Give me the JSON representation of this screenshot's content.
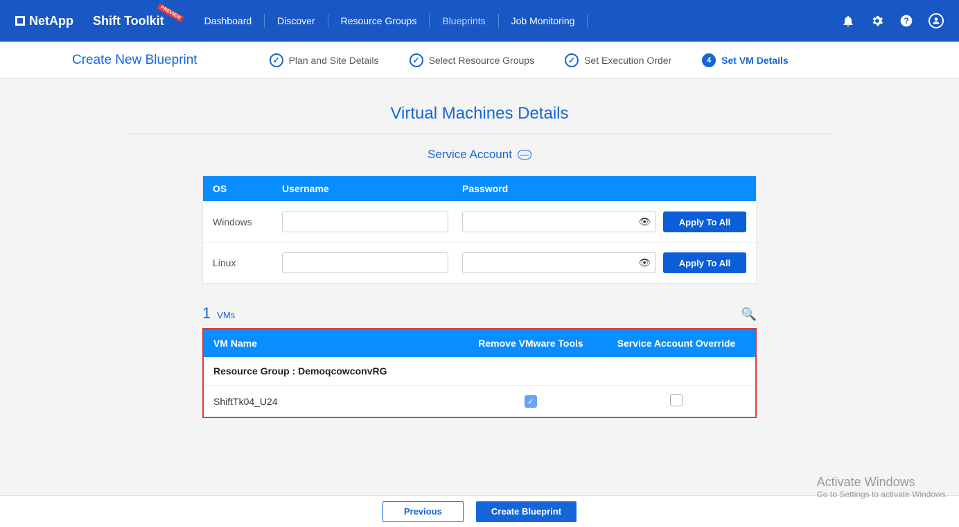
{
  "header": {
    "brand": "NetApp",
    "app_name": "Shift Toolkit",
    "preview_badge": "PREVIEW",
    "nav": [
      "Dashboard",
      "Discover",
      "Resource Groups",
      "Blueprints",
      "Job Monitoring"
    ],
    "active_nav_index": 3
  },
  "wizard": {
    "title": "Create New Blueprint",
    "steps": [
      {
        "label": "Plan and Site Details",
        "state": "done"
      },
      {
        "label": "Select Resource Groups",
        "state": "done"
      },
      {
        "label": "Set Execution Order",
        "state": "done"
      },
      {
        "label": "Set VM Details",
        "state": "active",
        "number": "4"
      }
    ]
  },
  "page": {
    "main_title": "Virtual Machines Details",
    "section_title": "Service Account",
    "columns": {
      "os": "OS",
      "username": "Username",
      "password": "Password"
    },
    "rows": [
      {
        "os": "Windows",
        "username": "",
        "password": "",
        "apply_label": "Apply To All"
      },
      {
        "os": "Linux",
        "username": "",
        "password": "",
        "apply_label": "Apply To All"
      }
    ],
    "vm_count": "1",
    "vm_count_label": "VMs",
    "vm_columns": {
      "name": "VM Name",
      "remove": "Remove VMware Tools",
      "override": "Service Account Override"
    },
    "resource_group_label": "Resource Group : DemoqcowconvRG",
    "vm_rows": [
      {
        "name": "ShiftTk04_U24",
        "remove_checked": true,
        "override_checked": false
      }
    ]
  },
  "footer": {
    "previous": "Previous",
    "create": "Create Blueprint"
  },
  "watermark": {
    "line1": "Activate Windows",
    "line2": "Go to Settings to activate Windows."
  }
}
